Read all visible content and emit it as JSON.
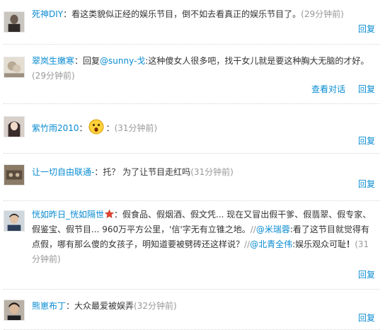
{
  "comments": [
    {
      "user": "死神DIY",
      "colon": "：",
      "text": "看这类貌似正经的娱乐节目，倒不如去看真正的娱乐节目了。",
      "time": "(29分钟前)",
      "reply": "回复"
    },
    {
      "user": "翠岚生嫩寒",
      "colon": "：回复",
      "mention": "@sunny-戈",
      "text": ":这种傻女人很多吧，找干女儿就是要这种胸大无脑的才好。",
      "time": "(29分钟前)",
      "view_conversation": "查看对话",
      "reply": "回复"
    },
    {
      "user": "紫竹雨2010",
      "colon": "：",
      "emoji": "surprised-emoji",
      "text": "：",
      "time": "(31分钟前)",
      "reply": "回复"
    },
    {
      "user": "让一切自由联通-",
      "colon": "：",
      "text": "托？ 为了让节目走红吗",
      "time": "(31分钟前)",
      "reply": "回复"
    },
    {
      "user": "恍如昨日_恍如隔世",
      "badge": "star-icon",
      "colon": "：",
      "text1": "假食品、假烟酒、假文凭... 现在又冒出假干爹、假翡翠、假专家、假鉴宝、假节目... 960万平方公里，'信'字无有立锥之地。",
      "sep1": "//",
      "mention1": "@米瑞蓉",
      "text2": ":看了这节目就觉得有点假，哪有那么傻的女孩子，明知道要被劈砖还这样说？",
      "sep2": "//",
      "mention2": "@北青全伟",
      "text3": ":娱乐观众可耻",
      "bang": "！",
      "time": "(31分钟前)",
      "reply": "回复"
    },
    {
      "user": "熊崽布丁",
      "colon": "：",
      "text": "大众最爱被娱弄",
      "time": "(32分钟前)",
      "reply": "回复"
    }
  ],
  "colors": {
    "link": "#0a8cd2",
    "muted": "#999999",
    "text": "#333333",
    "badge": "#e8412c"
  }
}
